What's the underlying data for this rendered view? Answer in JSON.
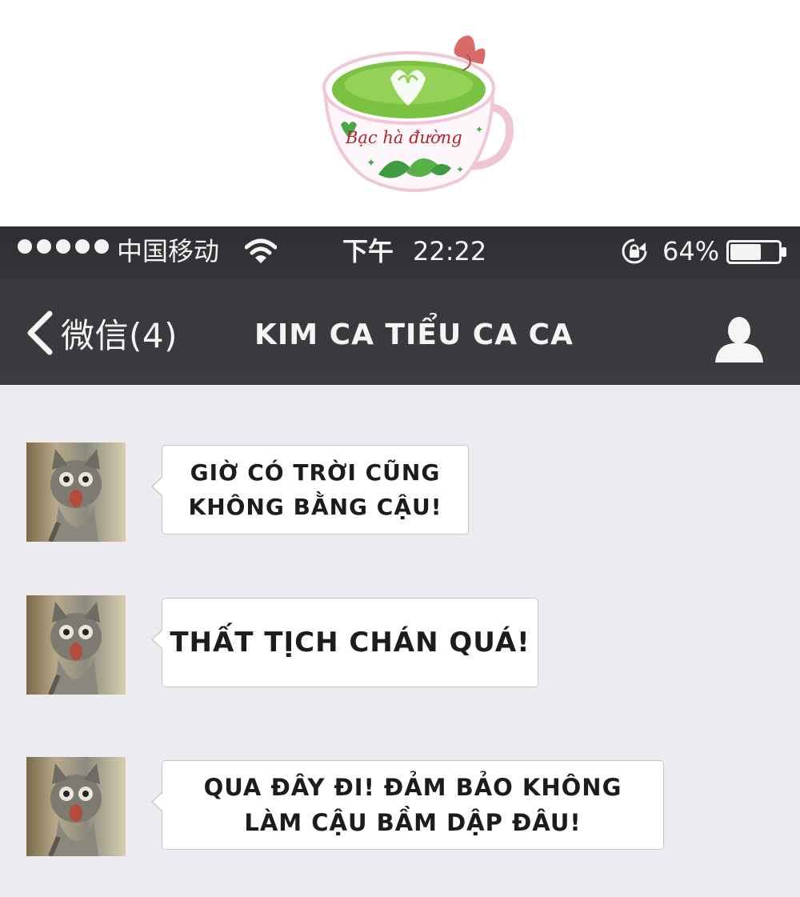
{
  "logo": {
    "text": "Bạc hà đường",
    "icon": "tea-cup-logo-icon"
  },
  "status_bar": {
    "signal_dots": 5,
    "carrier": "中国移动",
    "wifi_icon": "wifi-icon",
    "time_prefix": "下午",
    "time": "22:22",
    "lock_icon": "rotation-lock-icon",
    "battery_percent": "64%",
    "battery_level": 0.64
  },
  "nav_bar": {
    "back_label": "微信(4)",
    "back_icon": "chevron-left-icon",
    "title": "KIM CA TIỂU CA CA",
    "profile_icon": "person-icon"
  },
  "messages": [
    {
      "text": "GIỜ CÓ TRỜI CŨNG\nKHÔNG BẰNG CẬU!",
      "avatar": "cat-avatar"
    },
    {
      "text": "THẤT TỊCH CHÁN QUÁ!",
      "avatar": "cat-avatar"
    },
    {
      "text": "QUA ĐÂY ĐI! ĐẢM BẢO KHÔNG\nLÀM CẬU BẦM DẬP ĐÂU!",
      "avatar": "cat-avatar"
    }
  ],
  "colors": {
    "bar_background": "#38383d",
    "chat_background": "#ecebef",
    "bubble_background": "#ffffff",
    "logo_green": "#7cc242",
    "logo_text": "#b0262b"
  }
}
